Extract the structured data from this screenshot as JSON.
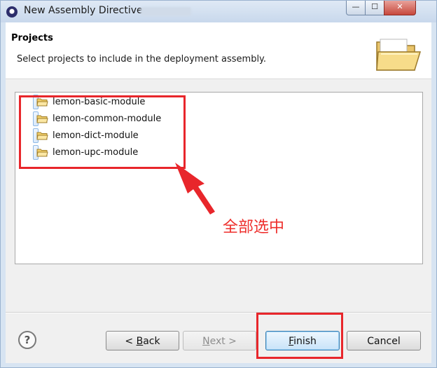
{
  "window": {
    "title": "New Assembly Directive",
    "minimize": "—",
    "maximize": "☐",
    "close": "✕"
  },
  "header": {
    "title": "Projects",
    "description": "Select projects to include in the deployment assembly."
  },
  "projects": [
    "lemon-basic-module",
    "lemon-common-module",
    "lemon-dict-module",
    "lemon-upc-module"
  ],
  "buttons": {
    "help": "?",
    "back_prefix": "< ",
    "back_mnemonic": "B",
    "back_rest": "ack",
    "next_mnemonic": "N",
    "next_rest": "ext >",
    "finish_mnemonic": "F",
    "finish_rest": "inish",
    "cancel": "Cancel"
  },
  "annotation": {
    "note": "全部选中",
    "color": "#e8262b"
  },
  "colors": {
    "selection_fill": "#d9e9fb",
    "selection_border": "#8fb9e6",
    "default_button_border": "#3c7fb1"
  }
}
